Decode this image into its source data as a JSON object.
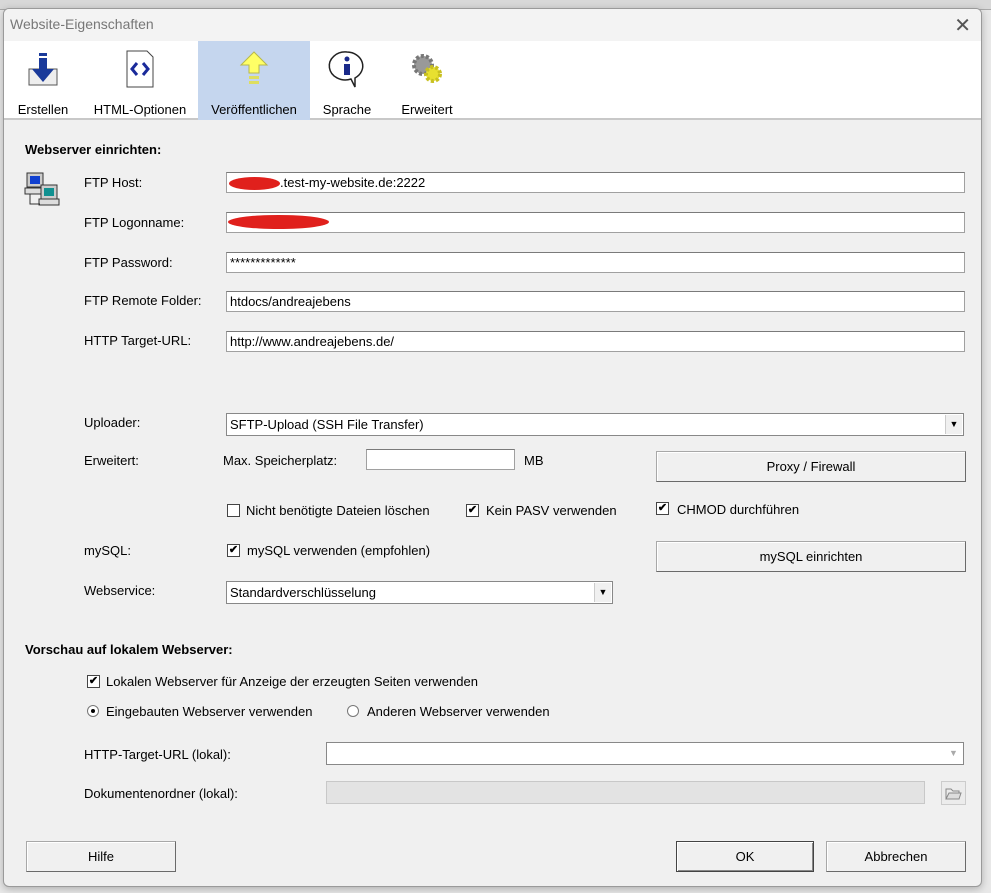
{
  "window": {
    "title": "Website-Eigenschaften",
    "close_icon": "close-icon"
  },
  "toolbar": {
    "tabs": [
      {
        "label": "Erstellen",
        "icon": "download-icon"
      },
      {
        "label": "HTML-Optionen",
        "icon": "html-file-icon"
      },
      {
        "label": "Veröffentlichen",
        "icon": "upload-arrow-icon",
        "active": true
      },
      {
        "label": "Sprache",
        "icon": "info-bubble-icon"
      },
      {
        "label": "Erweitert",
        "icon": "gears-icon"
      }
    ]
  },
  "webserver": {
    "heading": "Webserver einrichten:",
    "ftp_host": {
      "label": "FTP Host:",
      "value": ".test-my-website.de:2222"
    },
    "ftp_logon": {
      "label": "FTP Logonname:",
      "value": ""
    },
    "ftp_password": {
      "label": "FTP Password:",
      "value": "*************"
    },
    "ftp_remote": {
      "label": "FTP Remote Folder:",
      "value": "htdocs/andreajebens"
    },
    "http_target": {
      "label": "HTTP Target-URL:",
      "value": "http://www.andreajebens.de/"
    },
    "uploader": {
      "label": "Uploader:",
      "value": "SFTP-Upload (SSH File Transfer)"
    },
    "erweitert": {
      "label": "Erweitert:",
      "max_label": "Max. Speicherplatz:",
      "max_value": "",
      "unit": "MB",
      "proxy_button": "Proxy / Firewall"
    },
    "checks": {
      "delete": {
        "label": "Nicht benötigte Dateien löschen",
        "checked": false
      },
      "pasv": {
        "label": "Kein PASV verwenden",
        "checked": true
      },
      "chmod": {
        "label": "CHMOD durchführen",
        "checked": true
      }
    },
    "mysql": {
      "label": "mySQL:",
      "check_label": "mySQL verwenden (empfohlen)",
      "checked": true,
      "button": "mySQL einrichten"
    },
    "webservice": {
      "label": "Webservice:",
      "value": "Standardverschlüsselung"
    }
  },
  "preview": {
    "heading": "Vorschau auf lokalem Webserver:",
    "use_local": {
      "label": "Lokalen Webserver für Anzeige der erzeugten Seiten verwenden",
      "checked": true
    },
    "radio_builtin": {
      "label": "Eingebauten Webserver verwenden",
      "selected": true
    },
    "radio_other": {
      "label": "Anderen Webserver verwenden",
      "selected": false
    },
    "http_local": {
      "label": "HTTP-Target-URL (lokal):",
      "value": ""
    },
    "docfolder": {
      "label": "Dokumentenordner (lokal):",
      "value": ""
    }
  },
  "buttons": {
    "help": "Hilfe",
    "ok": "OK",
    "cancel": "Abbrechen"
  }
}
